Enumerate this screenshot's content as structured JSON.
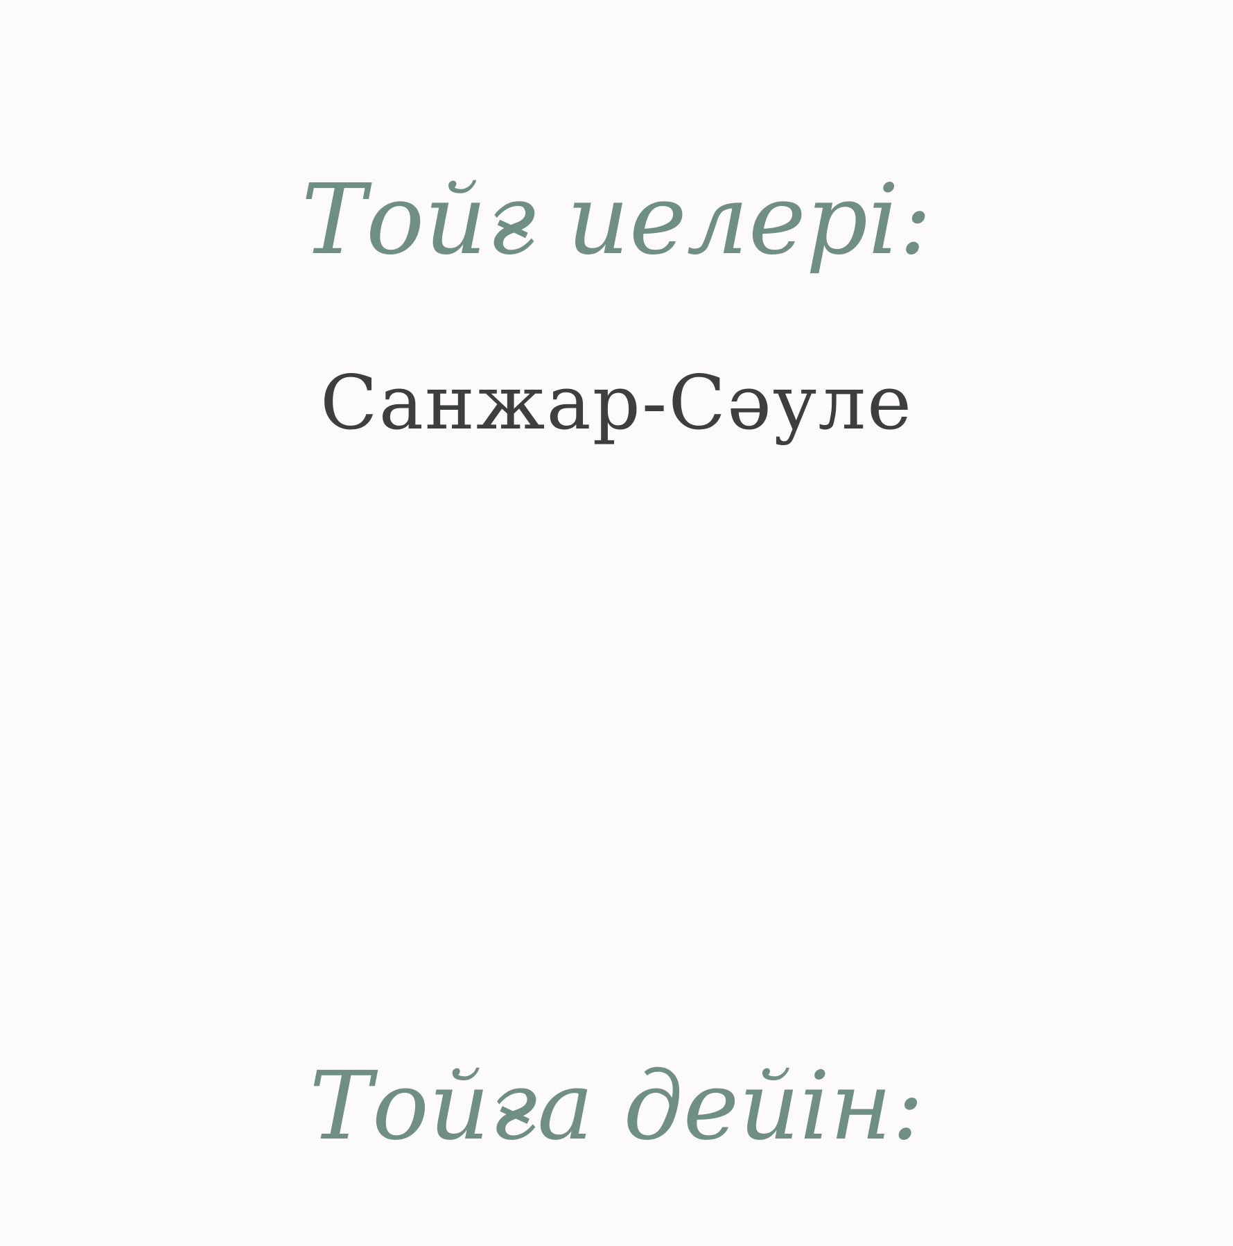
{
  "header": {
    "title": "Тойғ иелері:"
  },
  "couple": {
    "names": "Санжар-Сәуле"
  },
  "footer": {
    "title": "Тойға дейін:"
  },
  "colors": {
    "background": "#fcfbf9",
    "accent_green": "#6f8f82",
    "text_dark": "#3e3e3e"
  }
}
